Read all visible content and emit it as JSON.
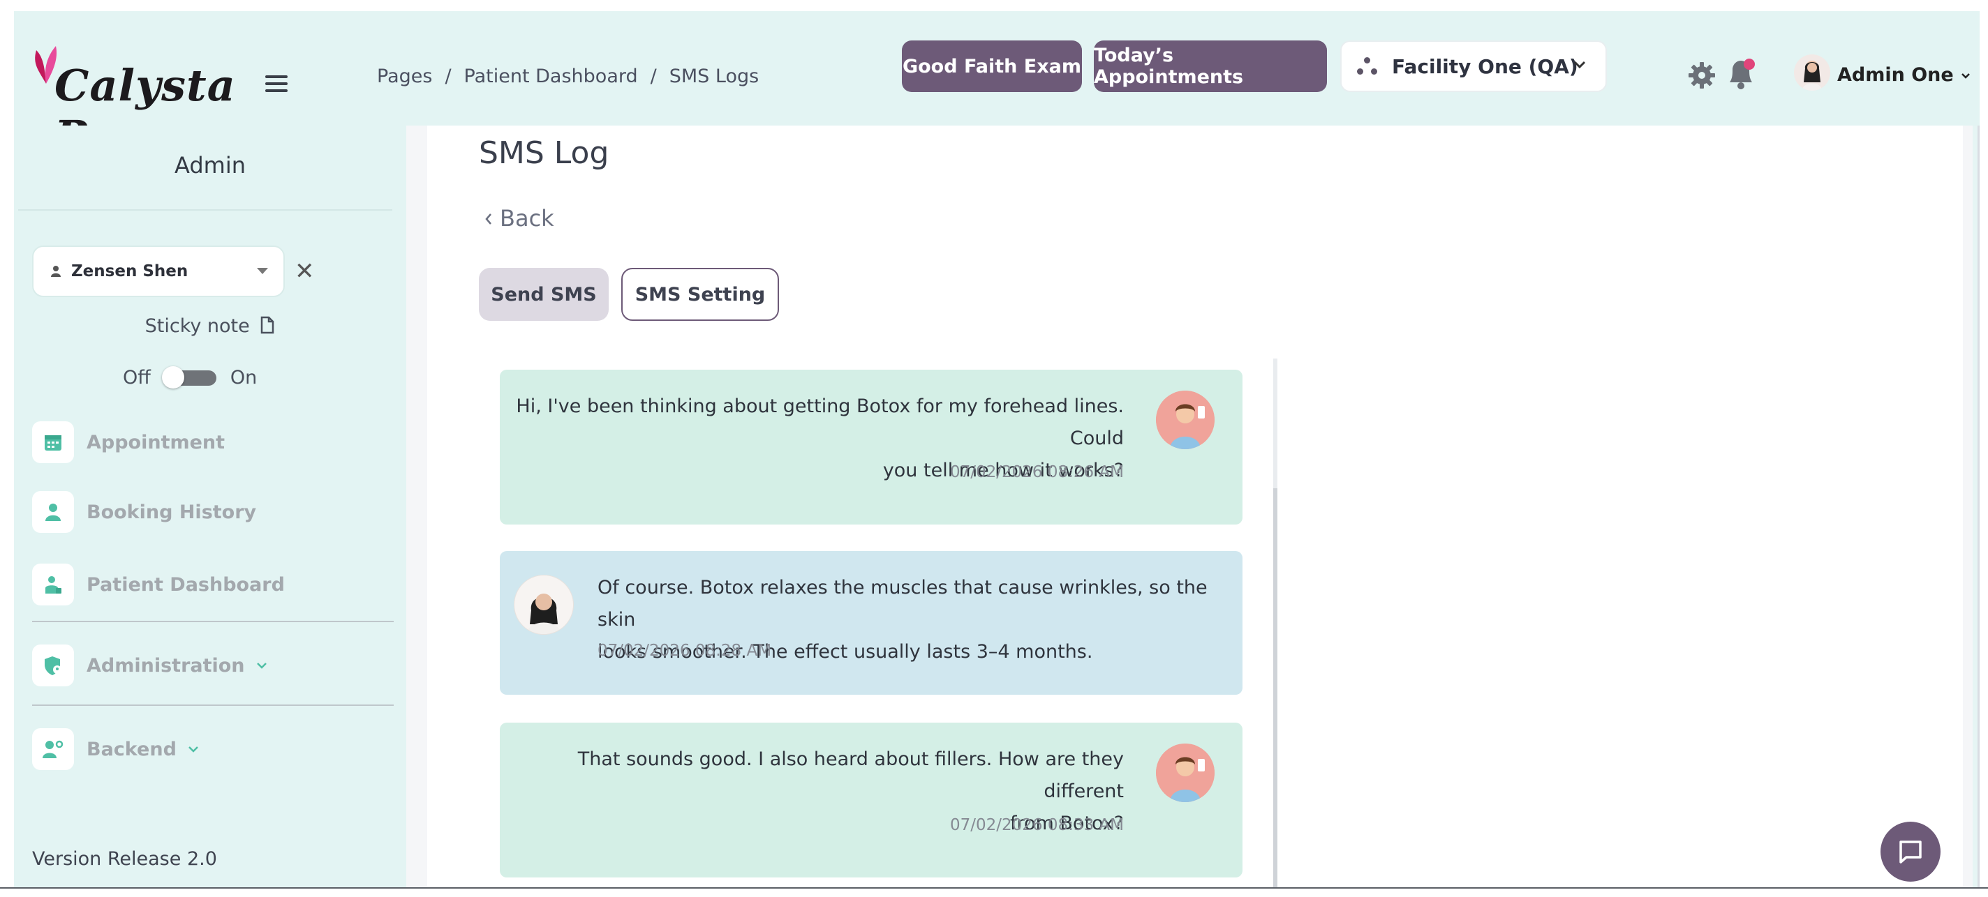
{
  "app": {
    "logo_text": "Calysta Pro"
  },
  "header": {
    "breadcrumb": [
      "Pages",
      "Patient Dashboard",
      "SMS Logs"
    ],
    "breadcrumb_sep": "/",
    "good_faith_exam": "Good Faith Exam",
    "todays_appointments": "Today’s Appointments",
    "facility": "Facility One (QA)",
    "user_name": "Admin One"
  },
  "sidebar": {
    "title": "Admin",
    "patient": "Zensen Shen",
    "sticky_note": "Sticky note",
    "toggle_off": "Off",
    "toggle_on": "On",
    "toggle_state": "off",
    "items": [
      {
        "label": "Appointment",
        "icon": "calendar-icon"
      },
      {
        "label": "Booking History",
        "icon": "person-icon"
      },
      {
        "label": "Patient Dashboard",
        "icon": "patient-icon"
      },
      {
        "label": "Administration",
        "icon": "shield-user-icon",
        "expandable": true
      },
      {
        "label": "Backend",
        "icon": "users-gear-icon",
        "expandable": true
      }
    ],
    "version": "Version Release 2.0"
  },
  "main": {
    "title": "SMS Log",
    "back": "Back",
    "tabs": [
      {
        "label": "Send SMS",
        "active": true
      },
      {
        "label": "SMS Setting",
        "active": false
      }
    ],
    "messages": [
      {
        "direction": "outgoing",
        "lines": [
          "Hi, I've been thinking about getting Botox for my forehead lines. Could",
          "you tell me how it works?"
        ],
        "time": "07/02/2026  08:26 AM"
      },
      {
        "direction": "incoming",
        "lines": [
          "Of course. Botox relaxes the muscles that cause wrinkles, so the skin",
          "looks smoother. The effect usually lasts 3–4 months."
        ],
        "time": "07/02/2026 08:28 AM"
      },
      {
        "direction": "outgoing",
        "lines": [
          "That sounds good. I also heard about fillers. How are they different",
          "from Botox?"
        ],
        "time": "07/02/2026  08:33 AM"
      }
    ]
  },
  "colors": {
    "accent": "#6d5a78",
    "header_bg": "#e3f4f3",
    "outgoing_bubble": "#d4efe6",
    "incoming_bubble": "#d0e7ef",
    "nav_teal": "#4fbfa5"
  }
}
